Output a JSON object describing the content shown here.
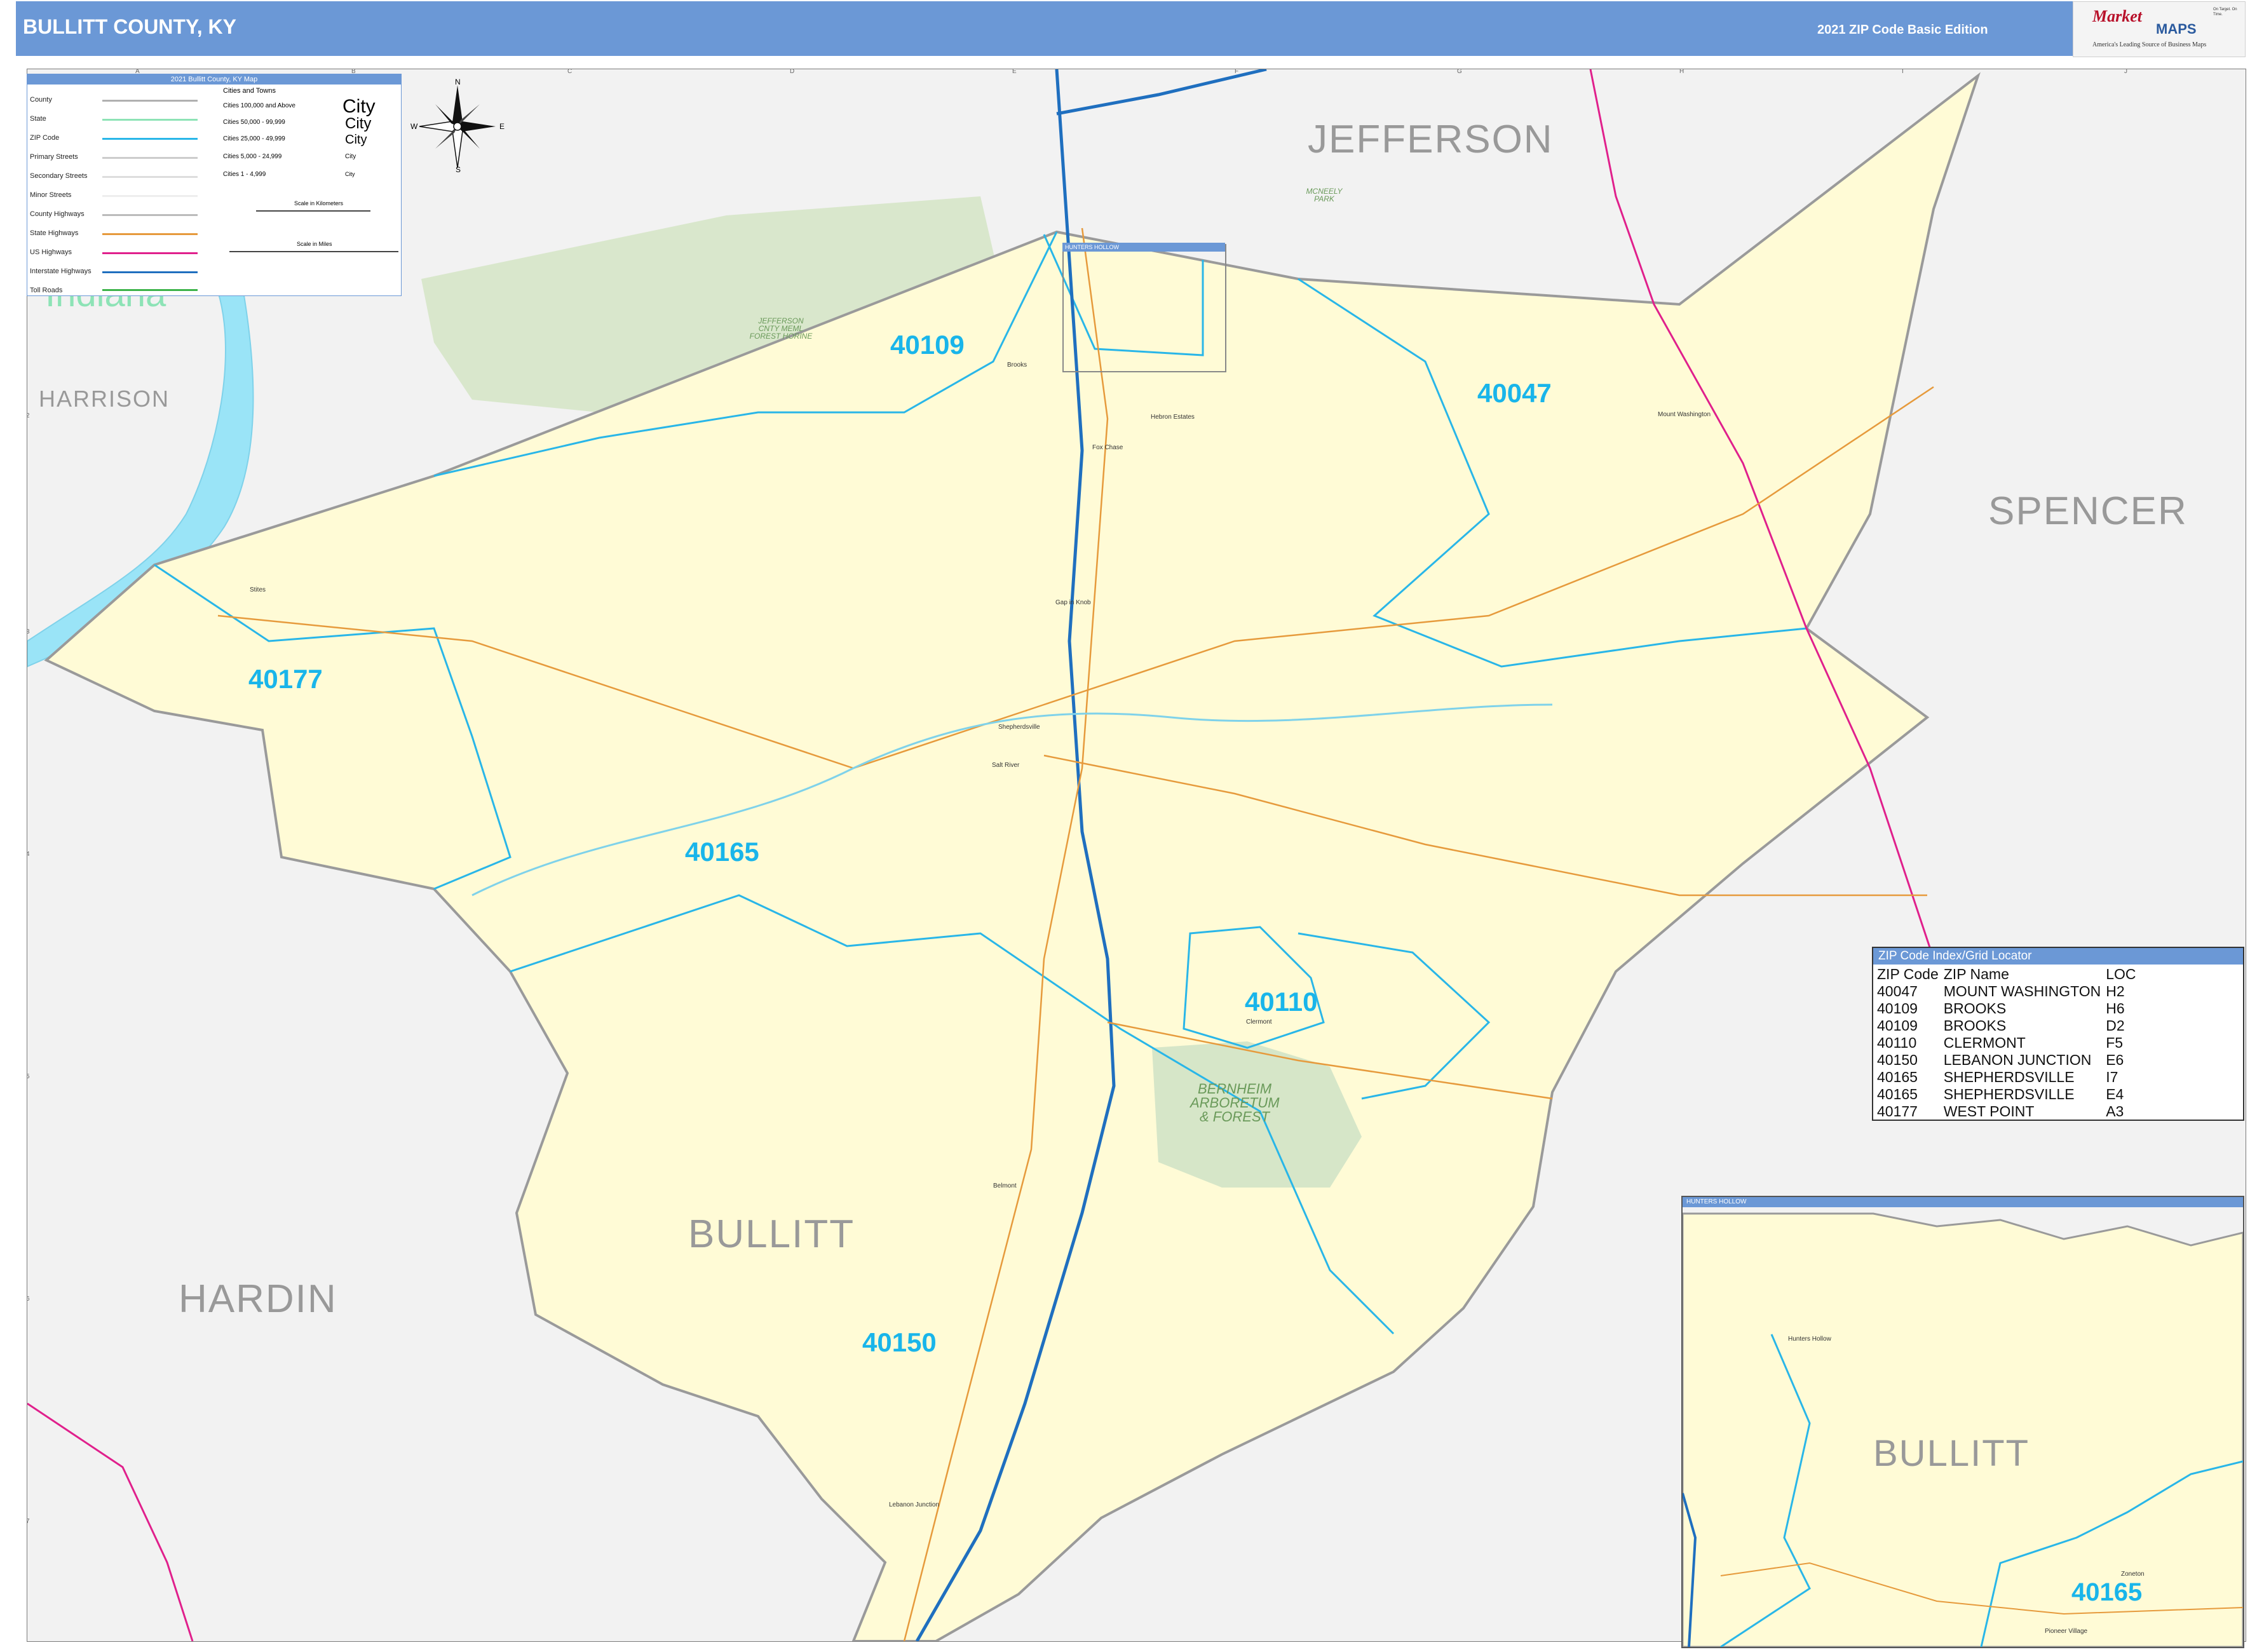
{
  "header": {
    "title": "BULLITT COUNTY, KY",
    "edition": "2021 ZIP Code Basic Edition"
  },
  "logo": {
    "brand_top": "Market",
    "brand_bottom": "MAPS",
    "tagline": "America's Leading Source of Business Maps",
    "slogan": "On Target. On Time."
  },
  "grid": {
    "columns": [
      "A",
      "B",
      "C",
      "D",
      "E",
      "F",
      "G",
      "H",
      "I",
      "J"
    ],
    "rows": [
      "1",
      "2",
      "3",
      "4",
      "5",
      "6",
      "7"
    ]
  },
  "legend": {
    "title": "2021 Bullitt County, KY Map",
    "items": [
      "County",
      "State",
      "ZIP Code",
      "Primary Streets",
      "Secondary Streets",
      "Minor Streets",
      "County Highways",
      "State Highways",
      "US Highways",
      "Interstate Highways",
      "Toll Roads"
    ],
    "cities_header": "Cities and Towns",
    "city_sizes": [
      {
        "range": "Cities 100,000 and Above",
        "sample": "City"
      },
      {
        "range": "Cities 50,000 - 99,999",
        "sample": "City"
      },
      {
        "range": "Cities 25,000 - 49,999",
        "sample": "City"
      },
      {
        "range": "Cities 5,000 - 24,999",
        "sample": "City"
      },
      {
        "range": "Cities 1 - 4,999",
        "sample": "City"
      }
    ],
    "scale_km": "Scale in Kilometers",
    "scale_mi": "Scale in Miles"
  },
  "compass": {
    "n": "N",
    "s": "S",
    "e": "E",
    "w": "W"
  },
  "counties": {
    "jefferson": "JEFFERSON",
    "harrison": "HARRISON",
    "spencer": "SPENCER",
    "hardin": "HARDIN",
    "bullitt": "BULLITT"
  },
  "state": "Indiana",
  "zips": {
    "z40109": "40109",
    "z40047": "40047",
    "z40177": "40177",
    "z40165": "40165",
    "z40110": "40110",
    "z40150": "40150"
  },
  "places": {
    "brooks": "Brooks",
    "hebron": "Hebron Estates",
    "fox_chase": "Fox Chase",
    "mount_washington": "Mount Washington",
    "sites": "Stites",
    "hillview": "Gap in Knob",
    "shepherdsville": "Shepherdsville",
    "salt_river": "Salt River",
    "clermont": "Clermont",
    "belmont": "Belmont",
    "lebanon_junction": "Lebanon Junction"
  },
  "parks": {
    "jefferson_forest": "JEFFERSON CNTY MEML FOREST HORINE",
    "bernheim": "BERNHEIM ARBORETUM & FOREST",
    "mckneely": "MCNEELY PARK"
  },
  "hunters_hollow_tab": "HUNTERS HOLLOW",
  "locator": {
    "title": "ZIP Code Index/Grid Locator",
    "headers": [
      "ZIP Code",
      "ZIP Name",
      "LOC"
    ],
    "rows": [
      [
        "40047",
        "MOUNT WASHINGTON",
        "H2"
      ],
      [
        "40109",
        "BROOKS",
        "H6"
      ],
      [
        "40109",
        "BROOKS",
        "D2"
      ],
      [
        "40110",
        "CLERMONT",
        "F5"
      ],
      [
        "40150",
        "LEBANON JUNCTION",
        "E6"
      ],
      [
        "40165",
        "SHEPHERDSVILLE",
        "I7"
      ],
      [
        "40165",
        "SHEPHERDSVILLE",
        "E4"
      ],
      [
        "40177",
        "WEST POINT",
        "A3"
      ]
    ]
  },
  "inset": {
    "title": "HUNTERS HOLLOW",
    "county": "BULLITT",
    "zip": "40165",
    "places": {
      "hunters_hollow": "Hunters Hollow",
      "zoneton": "Zoneton",
      "pioneer_village": "Pioneer Village"
    }
  },
  "colors": {
    "header_blue": "#6b98d6",
    "county_fill": "#fffbd6",
    "zip_boundary": "#29b6e8",
    "interstate": "#1f6fbf",
    "us_highway": "#e0208c",
    "state_highway": "#e69a3c",
    "water": "#9ae4f7",
    "park": "#d6e6c8",
    "zip_text": "#19b5ea",
    "county_text": "#999999"
  }
}
